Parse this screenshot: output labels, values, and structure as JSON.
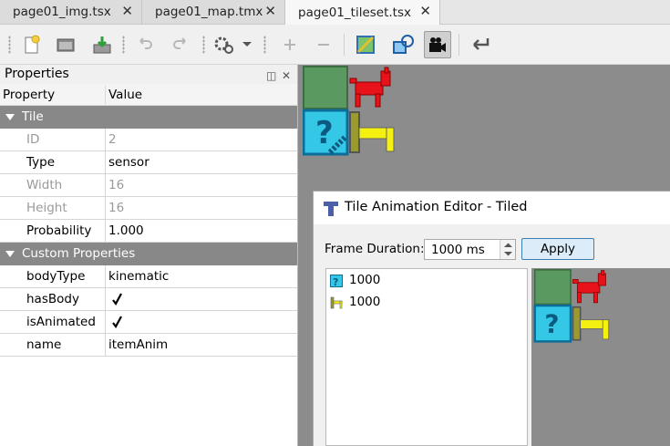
{
  "tabs": [
    {
      "label": "page01_img.tsx",
      "active": false
    },
    {
      "label": "page01_map.tmx",
      "active": false
    },
    {
      "label": "page01_tileset.tsx",
      "active": true
    }
  ],
  "toolbar": {
    "icons": [
      "new-tile-icon",
      "open-icon",
      "save-icon",
      "undo-icon",
      "redo-icon",
      "wang-sets-icon",
      "dropdown-arrow-icon",
      "add-tile-icon",
      "remove-tile-icon",
      "edit-terrain-icon",
      "edit-collision-icon",
      "tile-animation-icon",
      "dynamic-wrapping-icon"
    ]
  },
  "properties": {
    "title": "Properties",
    "col_property": "Property",
    "col_value": "Value",
    "group_tile": "Tile",
    "group_custom": "Custom Properties",
    "rows": [
      {
        "key": "ID",
        "value": "2"
      },
      {
        "key": "Type",
        "value": "sensor"
      },
      {
        "key": "Width",
        "value": "16"
      },
      {
        "key": "Height",
        "value": "16"
      },
      {
        "key": "Probability",
        "value": "1.000"
      }
    ],
    "custom_rows": [
      {
        "key": "bodyType",
        "value": "kinematic"
      },
      {
        "key": "hasBody",
        "value": ""
      },
      {
        "key": "isAnimated",
        "value": ""
      },
      {
        "key": "name",
        "value": "itemAnim"
      }
    ]
  },
  "dialog": {
    "title": "Tile Animation Editor - Tiled",
    "frame_duration_label": "Frame Duration:",
    "frame_duration_value": "1000 ms",
    "apply_label": "Apply",
    "frames": [
      {
        "duration": "1000",
        "icon": "question-block-icon"
      },
      {
        "duration": "1000",
        "icon": "spring-icon"
      }
    ]
  },
  "colors": {
    "group_row": "#888888",
    "tileset_bg": "#8c8c8c",
    "accent_blue": "#3c7fb1"
  }
}
